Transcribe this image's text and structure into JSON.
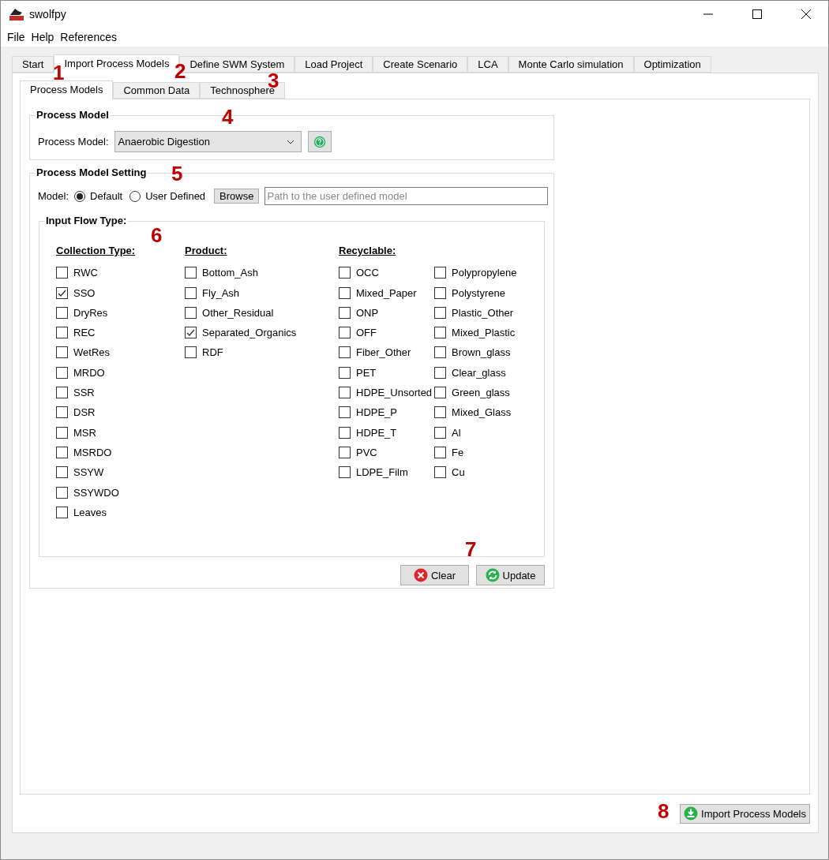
{
  "window": {
    "title": "swolfpy"
  },
  "menu": [
    "File",
    "Help",
    "References"
  ],
  "tabs": [
    {
      "label": "Start",
      "selected": false
    },
    {
      "label": "Import Process Models",
      "selected": true
    },
    {
      "label": "Define SWM System",
      "selected": false
    },
    {
      "label": "Load Project",
      "selected": false
    },
    {
      "label": "Create Scenario",
      "selected": false
    },
    {
      "label": "LCA",
      "selected": false
    },
    {
      "label": "Monte Carlo simulation",
      "selected": false
    },
    {
      "label": "Optimization",
      "selected": false
    }
  ],
  "subtabs": [
    {
      "label": "Process Models",
      "selected": true
    },
    {
      "label": "Common Data",
      "selected": false
    },
    {
      "label": "Technosphere",
      "selected": false
    }
  ],
  "process_model": {
    "title": "Process Model",
    "label": "Process Model:",
    "value": "Anaerobic Digestion"
  },
  "setting": {
    "title": "Process Model Setting",
    "label": "Model:",
    "options": [
      {
        "label": "Default",
        "selected": true
      },
      {
        "label": "User Defined",
        "selected": false
      }
    ],
    "browse": "Browse",
    "placeholder": "Path to the user defined model"
  },
  "input_flow": {
    "title": "Input Flow Type:",
    "groups": [
      {
        "heading": "Collection Type:",
        "item_columns": [
          [
            {
              "label": "RWC",
              "checked": false
            },
            {
              "label": "SSO",
              "checked": true
            },
            {
              "label": "DryRes",
              "checked": false
            },
            {
              "label": "REC",
              "checked": false
            },
            {
              "label": "WetRes",
              "checked": false
            },
            {
              "label": "MRDO",
              "checked": false
            },
            {
              "label": "SSR",
              "checked": false
            },
            {
              "label": "DSR",
              "checked": false
            },
            {
              "label": "MSR",
              "checked": false
            },
            {
              "label": "MSRDO",
              "checked": false
            },
            {
              "label": "SSYW",
              "checked": false
            },
            {
              "label": "SSYWDO",
              "checked": false
            },
            {
              "label": "Leaves",
              "checked": false
            }
          ]
        ]
      },
      {
        "heading": "Product:",
        "item_columns": [
          [
            {
              "label": "Bottom_Ash",
              "checked": false
            },
            {
              "label": "Fly_Ash",
              "checked": false
            },
            {
              "label": "Other_Residual",
              "checked": false
            },
            {
              "label": "Separated_Organics",
              "checked": true
            },
            {
              "label": "RDF",
              "checked": false
            }
          ]
        ]
      },
      {
        "heading": "Recyclable:",
        "item_columns": [
          [
            {
              "label": "OCC",
              "checked": false
            },
            {
              "label": "Mixed_Paper",
              "checked": false
            },
            {
              "label": "ONP",
              "checked": false
            },
            {
              "label": "OFF",
              "checked": false
            },
            {
              "label": "Fiber_Other",
              "checked": false
            },
            {
              "label": "PET",
              "checked": false
            },
            {
              "label": "HDPE_Unsorted",
              "checked": false
            },
            {
              "label": "HDPE_P",
              "checked": false
            },
            {
              "label": "HDPE_T",
              "checked": false
            },
            {
              "label": "PVC",
              "checked": false
            },
            {
              "label": "LDPE_Film",
              "checked": false
            }
          ],
          [
            {
              "label": "Polypropylene",
              "checked": false
            },
            {
              "label": "Polystyrene",
              "checked": false
            },
            {
              "label": "Plastic_Other",
              "checked": false
            },
            {
              "label": "Mixed_Plastic",
              "checked": false
            },
            {
              "label": "Brown_glass",
              "checked": false
            },
            {
              "label": "Clear_glass",
              "checked": false
            },
            {
              "label": "Green_glass",
              "checked": false
            },
            {
              "label": "Mixed_Glass",
              "checked": false
            },
            {
              "label": "Al",
              "checked": false
            },
            {
              "label": "Fe",
              "checked": false
            },
            {
              "label": "Cu",
              "checked": false
            }
          ]
        ]
      }
    ]
  },
  "actions": [
    {
      "kind": "clear",
      "label": "Clear"
    },
    {
      "kind": "update",
      "label": "Update"
    }
  ],
  "import_button": "Import Process Models",
  "callouts": [
    "1",
    "2",
    "3",
    "4",
    "5",
    "6",
    "7",
    "8"
  ]
}
